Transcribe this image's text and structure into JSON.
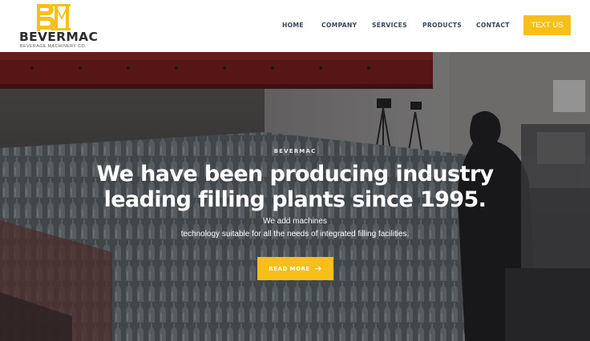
{
  "brand": {
    "name": "BEVERMAC",
    "tagline": "BEVERAGE MACHINERY CO.",
    "monogram": "BM",
    "color": "#f7bf17"
  },
  "nav": {
    "items": [
      "HOME",
      "COMPANY",
      "SERVICES",
      "PRODUCTS",
      "CONTACT"
    ],
    "cta": "TEXT US"
  },
  "hero": {
    "eyebrow": "BEVERMAC",
    "headline_line1": "We have been producing industry",
    "headline_line2": "leading filling plants since 1995.",
    "sub_line1": "We add machines",
    "sub_line2": "technology suitable for all the needs of integrated filling facilities.",
    "button": "READ MORE",
    "button_icon": "arrow-right-icon",
    "background": "bottling-line-photo"
  }
}
